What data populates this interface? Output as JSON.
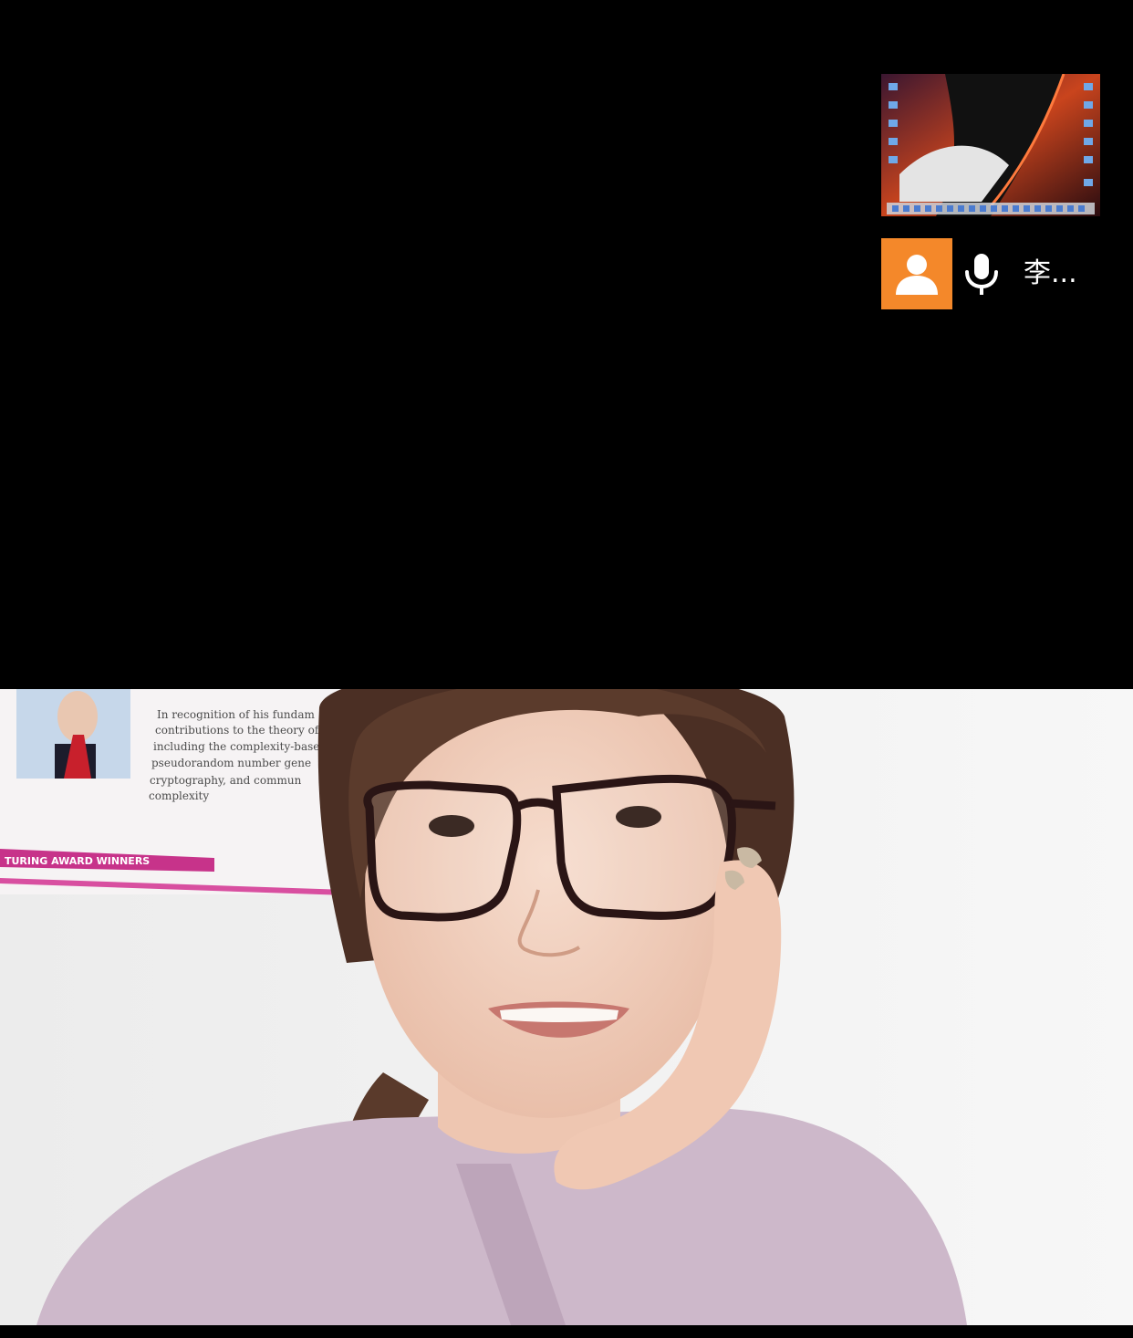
{
  "app": {
    "type": "video-call"
  },
  "shared_screen": {
    "label": ""
  },
  "participant": {
    "name": "李...",
    "avatar_icon": "person-icon",
    "mic_icon": "microphone-icon",
    "avatar_color": "#f4882a"
  },
  "camera_feed": {
    "poster": {
      "caption_lines": [
        "In recognition of his fundam",
        "contributions to the theory of comput",
        "including the complexity-based th",
        "pseudorandom number gene",
        "cryptography, and commun",
        "complexity"
      ],
      "banner": "TURING AWARD WINNERS"
    }
  }
}
